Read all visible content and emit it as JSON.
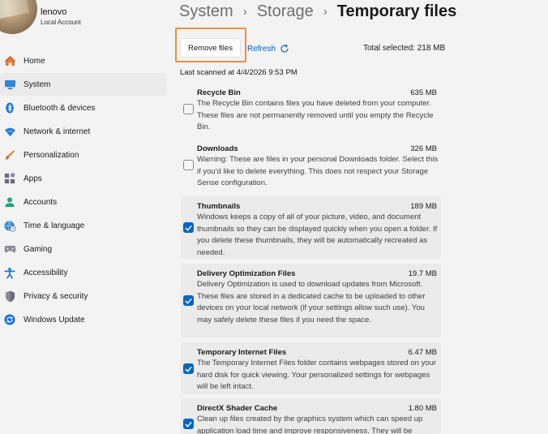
{
  "profile": {
    "name": "lenovo",
    "account_type": "Local Account"
  },
  "nav": [
    {
      "label": "Home",
      "icon": "home-icon",
      "active": false
    },
    {
      "label": "System",
      "icon": "system-icon",
      "active": true
    },
    {
      "label": "Bluetooth & devices",
      "icon": "bluetooth-icon",
      "active": false
    },
    {
      "label": "Network & internet",
      "icon": "wifi-icon",
      "active": false
    },
    {
      "label": "Personalization",
      "icon": "brush-icon",
      "active": false
    },
    {
      "label": "Apps",
      "icon": "apps-icon",
      "active": false
    },
    {
      "label": "Accounts",
      "icon": "account-icon",
      "active": false
    },
    {
      "label": "Time & language",
      "icon": "globe-clock-icon",
      "active": false
    },
    {
      "label": "Gaming",
      "icon": "gamepad-icon",
      "active": false
    },
    {
      "label": "Accessibility",
      "icon": "accessibility-icon",
      "active": false
    },
    {
      "label": "Privacy & security",
      "icon": "shield-icon",
      "active": false
    },
    {
      "label": "Windows Update",
      "icon": "update-icon",
      "active": false
    }
  ],
  "breadcrumb": {
    "level1": "System",
    "level2": "Storage",
    "current": "Temporary files",
    "separator": "›"
  },
  "actions": {
    "remove_label": "Remove files",
    "refresh_label": "Refresh",
    "total_selected": "Total selected: 218 MB"
  },
  "last_scanned": "Last scanned at 4/4/2026 9:53 PM",
  "items": [
    {
      "title": "Recycle Bin",
      "size": "635 MB",
      "checked": false,
      "description": "The Recycle Bin contains files you have deleted from your computer. These files are not permanently removed until you empty the Recycle Bin."
    },
    {
      "title": "Downloads",
      "size": "326 MB",
      "checked": false,
      "description": "Warning: These are files in your personal Downloads folder. Select this if you'd like to delete everything. This does not respect your Storage Sense configuration."
    },
    {
      "title": "Thumbnails",
      "size": "189 MB",
      "checked": true,
      "description": "Windows keeps a copy of all of your picture, video, and document thumbnails so they can be displayed quickly when you open a folder. If you delete these thumbnails, they will be automatically recreated as needed."
    },
    {
      "title": "Delivery Optimization Files",
      "size": "19.7 MB",
      "checked": true,
      "description": "Delivery Optimization is used to download updates from Microsoft. These files are stored in a dedicated cache to be uploaded to other devices on your local network (if your settings allow such use). You may safely delete these files if you need the space."
    },
    {
      "title": "Temporary Internet Files",
      "size": "6.47 MB",
      "checked": true,
      "description": "The Temporary Internet Files folder contains webpages stored on your hard disk for quick viewing. Your personalized settings for webpages will be left intact."
    },
    {
      "title": "DirectX Shader Cache",
      "size": "1.80 MB",
      "checked": true,
      "description": "Clean up files created by the graphics system which can speed up application load time and improve responsiveness. They will be"
    }
  ],
  "colors": {
    "accent": "#0067c0",
    "link": "#005fb8",
    "highlight": "#f08c3c",
    "window_bg": "#f3f3f3",
    "card_checked_bg": "#ebebeb"
  }
}
